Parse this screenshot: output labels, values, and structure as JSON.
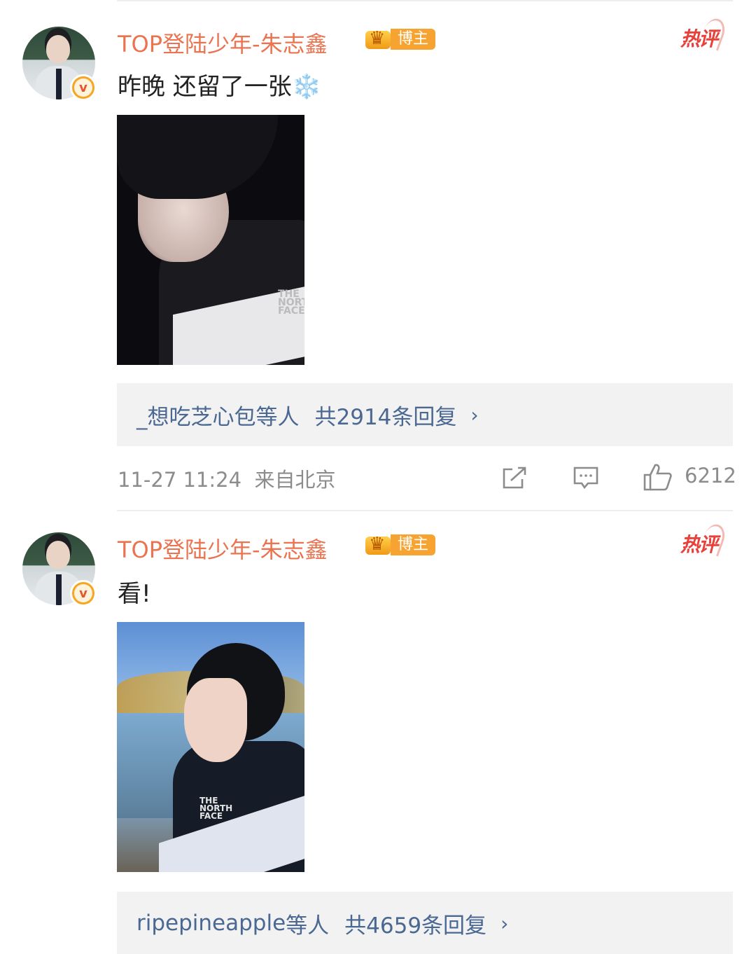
{
  "comments": [
    {
      "username": "TOP登陆少年-朱志鑫",
      "badge_label": "博主",
      "hot_label": "热评",
      "verified_mark": "v",
      "text": "昨晚 还留了一张",
      "emoji": "❄️",
      "reply_users": "_想吃芝心包",
      "reply_suffix": "等人",
      "reply_count": "共2914条回复",
      "chevron": "›",
      "time": "11-27 11:24",
      "location": "来自北京",
      "likes": "6212",
      "photo_logo": "THE NORTH FACE"
    },
    {
      "username": "TOP登陆少年-朱志鑫",
      "badge_label": "博主",
      "hot_label": "热评",
      "verified_mark": "v",
      "text": "看!",
      "reply_users": "ripepineapple",
      "reply_suffix": "等人",
      "reply_count": "共4659条回复",
      "chevron": "›",
      "photo_logo": "THE NORTH FACE"
    }
  ],
  "colors": {
    "username": "#eb7350",
    "badge": "#f7a331",
    "hot": "#e8403a",
    "link": "#4a6892",
    "meta": "#8c8c8c",
    "reply_bg": "#f2f2f2"
  },
  "icons": [
    "verified-icon",
    "crown-icon",
    "share-icon",
    "comment-icon",
    "like-icon",
    "chevron-right-icon"
  ]
}
